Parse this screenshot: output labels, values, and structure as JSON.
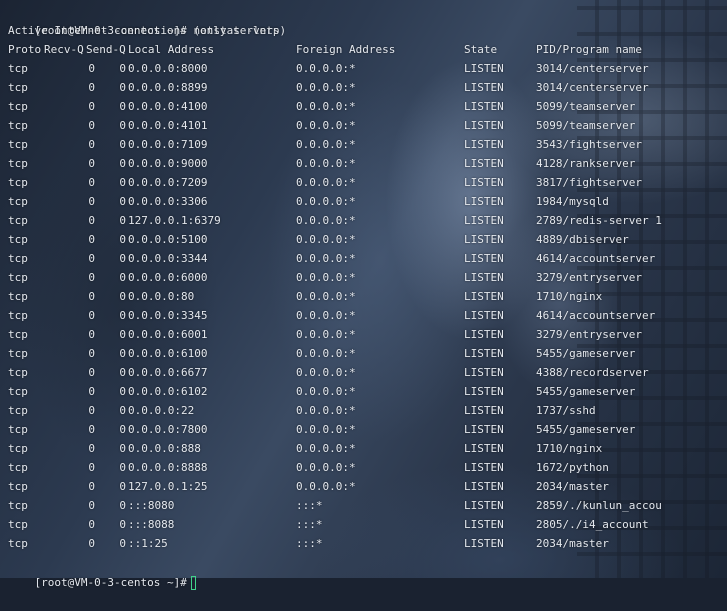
{
  "terminal": {
    "prompt": "[root@VM-0-3-centos ~]#",
    "command": "netstat -lntp",
    "banner": "Active Internet connections (only servers)",
    "headers": [
      "Proto",
      "Recv-Q",
      "Send-Q",
      "Local Address",
      "Foreign Address",
      "State",
      "PID/Program name"
    ],
    "rows": [
      [
        "tcp",
        "0",
        "0",
        "0.0.0.0:8000",
        "0.0.0.0:*",
        "LISTEN",
        "3014/centerserver"
      ],
      [
        "tcp",
        "0",
        "0",
        "0.0.0.0:8899",
        "0.0.0.0:*",
        "LISTEN",
        "3014/centerserver"
      ],
      [
        "tcp",
        "0",
        "0",
        "0.0.0.0:4100",
        "0.0.0.0:*",
        "LISTEN",
        "5099/teamserver"
      ],
      [
        "tcp",
        "0",
        "0",
        "0.0.0.0:4101",
        "0.0.0.0:*",
        "LISTEN",
        "5099/teamserver"
      ],
      [
        "tcp",
        "0",
        "0",
        "0.0.0.0:7109",
        "0.0.0.0:*",
        "LISTEN",
        "3543/fightserver"
      ],
      [
        "tcp",
        "0",
        "0",
        "0.0.0.0:9000",
        "0.0.0.0:*",
        "LISTEN",
        "4128/rankserver"
      ],
      [
        "tcp",
        "0",
        "0",
        "0.0.0.0:7209",
        "0.0.0.0:*",
        "LISTEN",
        "3817/fightserver"
      ],
      [
        "tcp",
        "0",
        "0",
        "0.0.0.0:3306",
        "0.0.0.0:*",
        "LISTEN",
        "1984/mysqld"
      ],
      [
        "tcp",
        "0",
        "0",
        "127.0.0.1:6379",
        "0.0.0.0:*",
        "LISTEN",
        "2789/redis-server 1"
      ],
      [
        "tcp",
        "0",
        "0",
        "0.0.0.0:5100",
        "0.0.0.0:*",
        "LISTEN",
        "4889/dbiserver"
      ],
      [
        "tcp",
        "0",
        "0",
        "0.0.0.0:3344",
        "0.0.0.0:*",
        "LISTEN",
        "4614/accountserver"
      ],
      [
        "tcp",
        "0",
        "0",
        "0.0.0.0:6000",
        "0.0.0.0:*",
        "LISTEN",
        "3279/entryserver"
      ],
      [
        "tcp",
        "0",
        "0",
        "0.0.0.0:80",
        "0.0.0.0:*",
        "LISTEN",
        "1710/nginx"
      ],
      [
        "tcp",
        "0",
        "0",
        "0.0.0.0:3345",
        "0.0.0.0:*",
        "LISTEN",
        "4614/accountserver"
      ],
      [
        "tcp",
        "0",
        "0",
        "0.0.0.0:6001",
        "0.0.0.0:*",
        "LISTEN",
        "3279/entryserver"
      ],
      [
        "tcp",
        "0",
        "0",
        "0.0.0.0:6100",
        "0.0.0.0:*",
        "LISTEN",
        "5455/gameserver"
      ],
      [
        "tcp",
        "0",
        "0",
        "0.0.0.0:6677",
        "0.0.0.0:*",
        "LISTEN",
        "4388/recordserver"
      ],
      [
        "tcp",
        "0",
        "0",
        "0.0.0.0:6102",
        "0.0.0.0:*",
        "LISTEN",
        "5455/gameserver"
      ],
      [
        "tcp",
        "0",
        "0",
        "0.0.0.0:22",
        "0.0.0.0:*",
        "LISTEN",
        "1737/sshd"
      ],
      [
        "tcp",
        "0",
        "0",
        "0.0.0.0:7800",
        "0.0.0.0:*",
        "LISTEN",
        "5455/gameserver"
      ],
      [
        "tcp",
        "0",
        "0",
        "0.0.0.0:888",
        "0.0.0.0:*",
        "LISTEN",
        "1710/nginx"
      ],
      [
        "tcp",
        "0",
        "0",
        "0.0.0.0:8888",
        "0.0.0.0:*",
        "LISTEN",
        "1672/python"
      ],
      [
        "tcp",
        "0",
        "0",
        "127.0.0.1:25",
        "0.0.0.0:*",
        "LISTEN",
        "2034/master"
      ],
      [
        "tcp",
        "0",
        "0",
        ":::8080",
        ":::*",
        "LISTEN",
        "2859/./kunlun_accou"
      ],
      [
        "tcp",
        "0",
        "0",
        ":::8088",
        ":::*",
        "LISTEN",
        "2805/./i4_account"
      ],
      [
        "tcp",
        "0",
        "0",
        "::1:25",
        ":::*",
        "LISTEN",
        "2034/master"
      ]
    ],
    "final_prompt": "[root@VM-0-3-centos ~]#",
    "cursor_color": "#41d38a",
    "text_color": "#e4e8ee"
  }
}
